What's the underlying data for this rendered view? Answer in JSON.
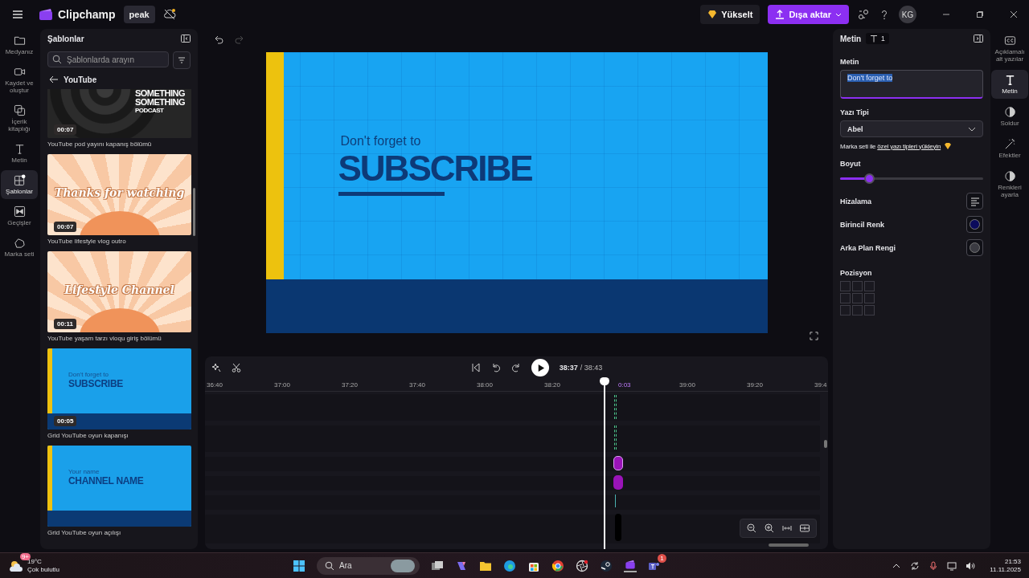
{
  "topbar": {
    "app_name": "Clipchamp",
    "project_name": "peak",
    "upgrade": "Yükselt",
    "export": "Dışa aktar",
    "avatar": "KG"
  },
  "left_rail": [
    {
      "label": "Medyanız",
      "selected": false
    },
    {
      "label": "Kaydet ve oluştur",
      "selected": false
    },
    {
      "label": "İçerik kitaplığı",
      "selected": false
    },
    {
      "label": "Metin",
      "selected": false
    },
    {
      "label": "Şablonlar",
      "selected": true
    },
    {
      "label": "Geçişler",
      "selected": false
    },
    {
      "label": "Marka seti",
      "selected": false
    }
  ],
  "templates_panel": {
    "title": "Şablonlar",
    "search": {
      "placeholder": "Şablonlarda arayın"
    },
    "category": "YouTube",
    "items": [
      {
        "kind": "podcast",
        "lines": [
          "SOMETHING",
          "SOMETHING",
          "PODCAST"
        ],
        "duration": "00:07",
        "label": "YouTube pod yayını kapanış bölümü"
      },
      {
        "kind": "sunburst",
        "headline": "Thanks for watching",
        "duration": "00:07",
        "label": "YouTube lifestyle vlog outro"
      },
      {
        "kind": "sunburst",
        "headline": "Lifestyle Channel",
        "duration": "00:11",
        "label": "YouTube yaşam tarzı vloqu giriş bölümü"
      },
      {
        "kind": "grid",
        "kicker": "Don't forget to",
        "headline": "SUBSCRIBE",
        "duration": "00:05",
        "label": "Grid YouTube oyun kapanışı"
      },
      {
        "kind": "grid",
        "kicker": "Your name",
        "headline": "CHANNEL NAME",
        "label": "Grid YouTube oyun açılışı"
      }
    ]
  },
  "canvas": {
    "kicker": "Don't forget to",
    "headline": "SUBSCRIBE"
  },
  "playback": {
    "current": "38:37",
    "total": "/ 38:43"
  },
  "ruler": [
    {
      "kind": "time",
      "text": "36:40"
    },
    {
      "kind": "time",
      "text": "37:00"
    },
    {
      "kind": "time",
      "text": "37:20"
    },
    {
      "kind": "time",
      "text": "37:40"
    },
    {
      "kind": "time",
      "text": "38:00"
    },
    {
      "kind": "time",
      "text": "38:20"
    },
    {
      "kind": "playhead",
      "text": "0:03"
    },
    {
      "kind": "time",
      "text": "39:00"
    },
    {
      "kind": "time",
      "text": "39:20"
    },
    {
      "kind": "time",
      "text": "39:4"
    }
  ],
  "properties": {
    "title": "Metin",
    "count": "1",
    "text_label": "Metin",
    "text_value": "Don't forget to",
    "font_label": "Yazı Tipi",
    "font_value": "Abel",
    "hint": "Marka seti ile ",
    "hint_link": "özel yazı tipleri yükleyin",
    "size_label": "Boyut",
    "size": {
      "level": 0.2
    },
    "rows": [
      {
        "kind": "align",
        "label": "Hizalama"
      },
      {
        "kind": "color",
        "label": "Birincil Renk",
        "color": "#0b0b5c"
      },
      {
        "kind": "color",
        "label": "Arka Plan Rengi",
        "color": "#3b3b42"
      }
    ],
    "position_label": "Pozisyon"
  },
  "right_rail": [
    {
      "label": "Açıklamalı alt yazılar",
      "selected": false
    },
    {
      "label": "Metin",
      "selected": true
    },
    {
      "label": "Soldur",
      "selected": false
    },
    {
      "label": "Efektler",
      "selected": false
    },
    {
      "label": "Renkleri ayarla",
      "selected": false
    }
  ],
  "taskbar": {
    "weather_badge": "9+",
    "temperature": "19°C",
    "weather": "Çok bulutlu",
    "search": "Ara",
    "app_badge": "1",
    "time": "21:53",
    "date": "11.11.2025"
  }
}
